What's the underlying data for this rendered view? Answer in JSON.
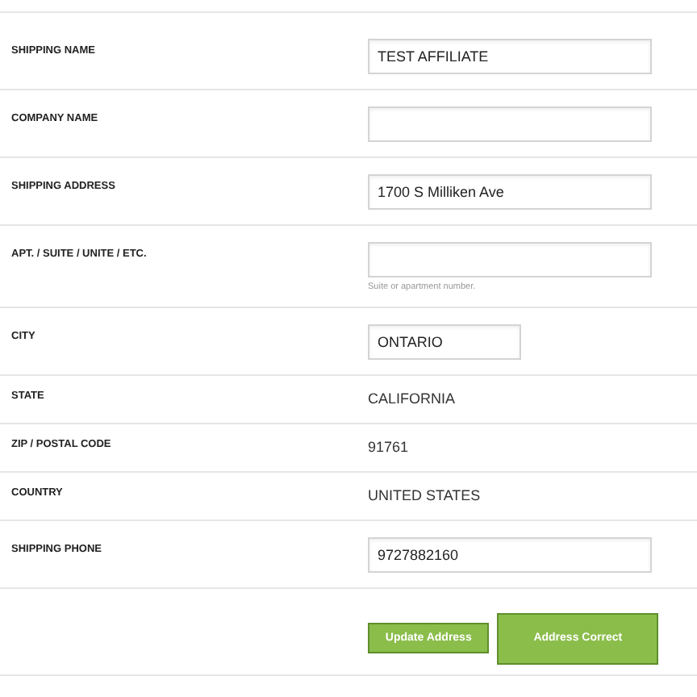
{
  "fields": [
    {
      "label": "SHIPPING NAME",
      "kind": "input",
      "value": "TEST AFFILIATE"
    },
    {
      "label": "COMPANY NAME",
      "kind": "input"
    },
    {
      "label": "SHIPPING ADDRESS",
      "kind": "input",
      "value": "1700 S Milliken Ave"
    },
    {
      "label": "APT. / SUITE / UNITE / ETC.",
      "kind": "input",
      "help": "Suite or apartment number."
    },
    {
      "label": "CITY",
      "kind": "short-input",
      "value": "ONTARIO"
    },
    {
      "label": "STATE",
      "kind": "text",
      "value": "CALIFORNIA"
    },
    {
      "label": "ZIP / POSTAL CODE",
      "kind": "text",
      "value": "91761"
    },
    {
      "label": "COUNTRY",
      "kind": "text",
      "value": "UNITED STATES"
    },
    {
      "label": "SHIPPING PHONE",
      "kind": "input",
      "value": "9727882160"
    }
  ],
  "buttons": [
    {
      "label": "Update Address",
      "kind": "small"
    },
    {
      "label": "Address Correct",
      "kind": "large"
    }
  ]
}
